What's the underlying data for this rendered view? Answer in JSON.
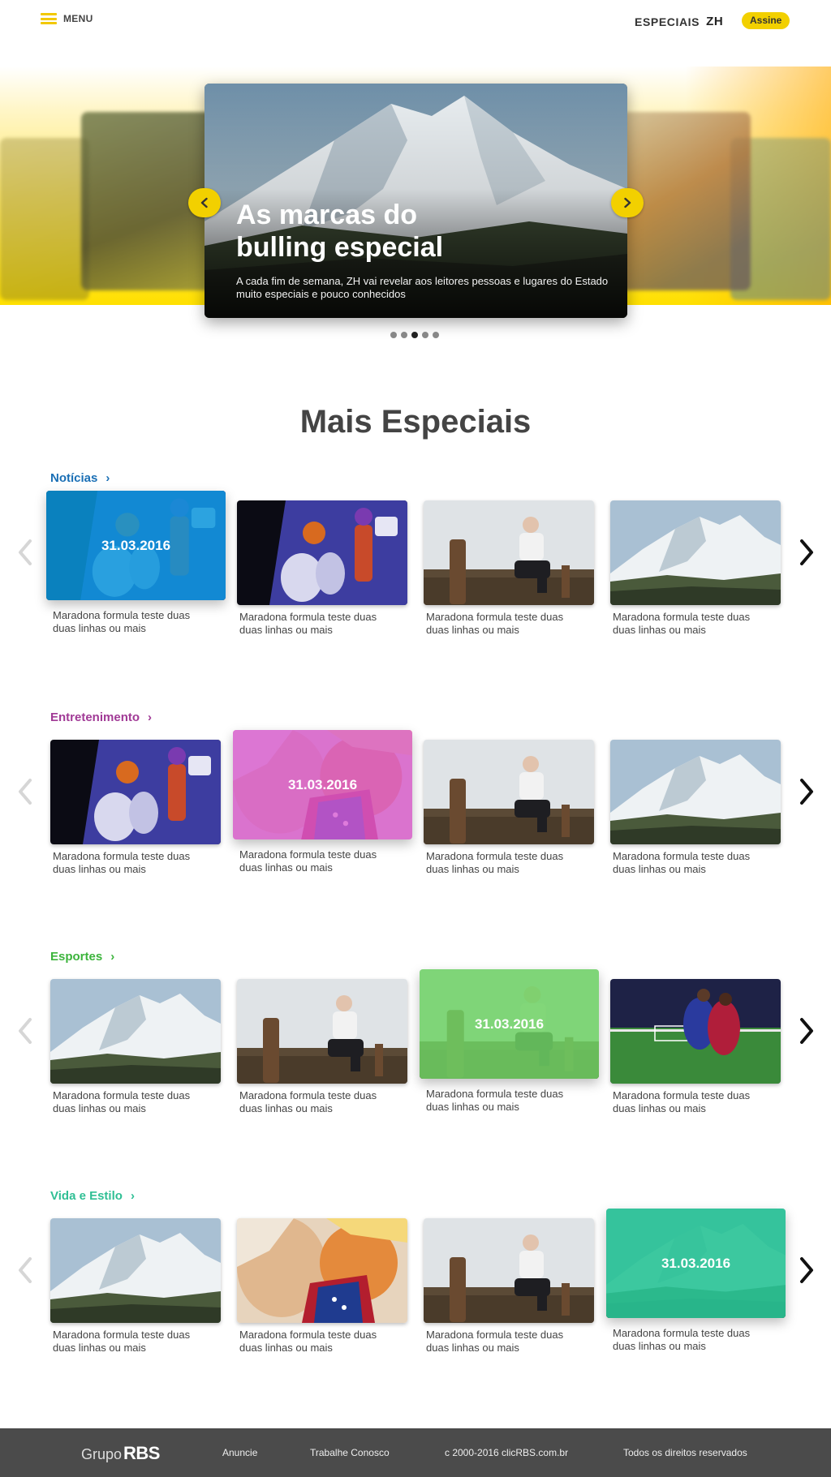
{
  "header": {
    "menu_label": "MENU",
    "brand_label": "ESPECIAIS",
    "brand_logo": "ZH",
    "subscribe_label": "Assine",
    "accent_color": "#f2d000"
  },
  "hero": {
    "title_line1": "As marcas do",
    "title_line2": "bulling especial",
    "description": "A cada fim de semana, ZH vai revelar aos leitores pessoas e lugares do Estado muito especiais e pouco conhecidos",
    "slide_count": 5,
    "active_slide": 3,
    "prev_icon": "chevron-left-icon",
    "next_icon": "chevron-right-icon"
  },
  "more_section": {
    "title": "Mais Especiais"
  },
  "categories": [
    {
      "title": "Notícias",
      "color": "#1a6fb5",
      "date": "31.03.2016",
      "featured_index": 0,
      "cards": [
        {
          "caption": "Maradona formula teste duas duas linhas ou mais",
          "image": "cartoon"
        },
        {
          "caption": "Maradona formula teste duas duas linhas ou mais",
          "image": "cartoon"
        },
        {
          "caption": "Maradona formula teste duas duas linhas ou mais",
          "image": "man"
        },
        {
          "caption": "Maradona formula teste duas duas linhas ou mais",
          "image": "mountain"
        }
      ]
    },
    {
      "title": "Entretenimento",
      "color": "#a13a96",
      "date": "31.03.2016",
      "featured_index": 1,
      "cards": [
        {
          "caption": "Maradona formula teste duas duas linhas ou mais",
          "image": "cartoon"
        },
        {
          "caption": "Maradona formula teste duas duas linhas ou mais",
          "image": "politics"
        },
        {
          "caption": "Maradona formula teste duas duas linhas ou mais",
          "image": "man"
        },
        {
          "caption": "Maradona formula teste duas duas linhas ou mais",
          "image": "mountain"
        }
      ]
    },
    {
      "title": "Esportes",
      "color": "#3cb43c",
      "date": "31.03.2016",
      "featured_index": 2,
      "cards": [
        {
          "caption": "Maradona formula teste duas duas linhas ou mais",
          "image": "mountain"
        },
        {
          "caption": "Maradona formula teste duas duas linhas ou mais",
          "image": "man"
        },
        {
          "caption": "Maradona formula teste duas duas linhas ou mais",
          "image": "man"
        },
        {
          "caption": "Maradona formula teste duas duas linhas ou mais",
          "image": "soccer"
        }
      ]
    },
    {
      "title": "Vida e Estilo",
      "color": "#2fbf94",
      "date": "31.03.2016",
      "featured_index": 3,
      "cards": [
        {
          "caption": "Maradona formula teste duas duas linhas ou mais",
          "image": "mountain"
        },
        {
          "caption": "Maradona formula teste duas duas linhas ou mais",
          "image": "politics"
        },
        {
          "caption": "Maradona formula teste duas duas linhas ou mais",
          "image": "man"
        },
        {
          "caption": "Maradona formula teste duas duas linhas ou mais",
          "image": "mountain"
        }
      ]
    }
  ],
  "footer": {
    "logo_grupo": "Grupo",
    "logo_rbs": "RBS",
    "links": [
      "Anuncie",
      "Trabalhe Conosco",
      "c 2000-2016 clicRBS.com.br",
      "Todos os direitos reservados"
    ]
  }
}
